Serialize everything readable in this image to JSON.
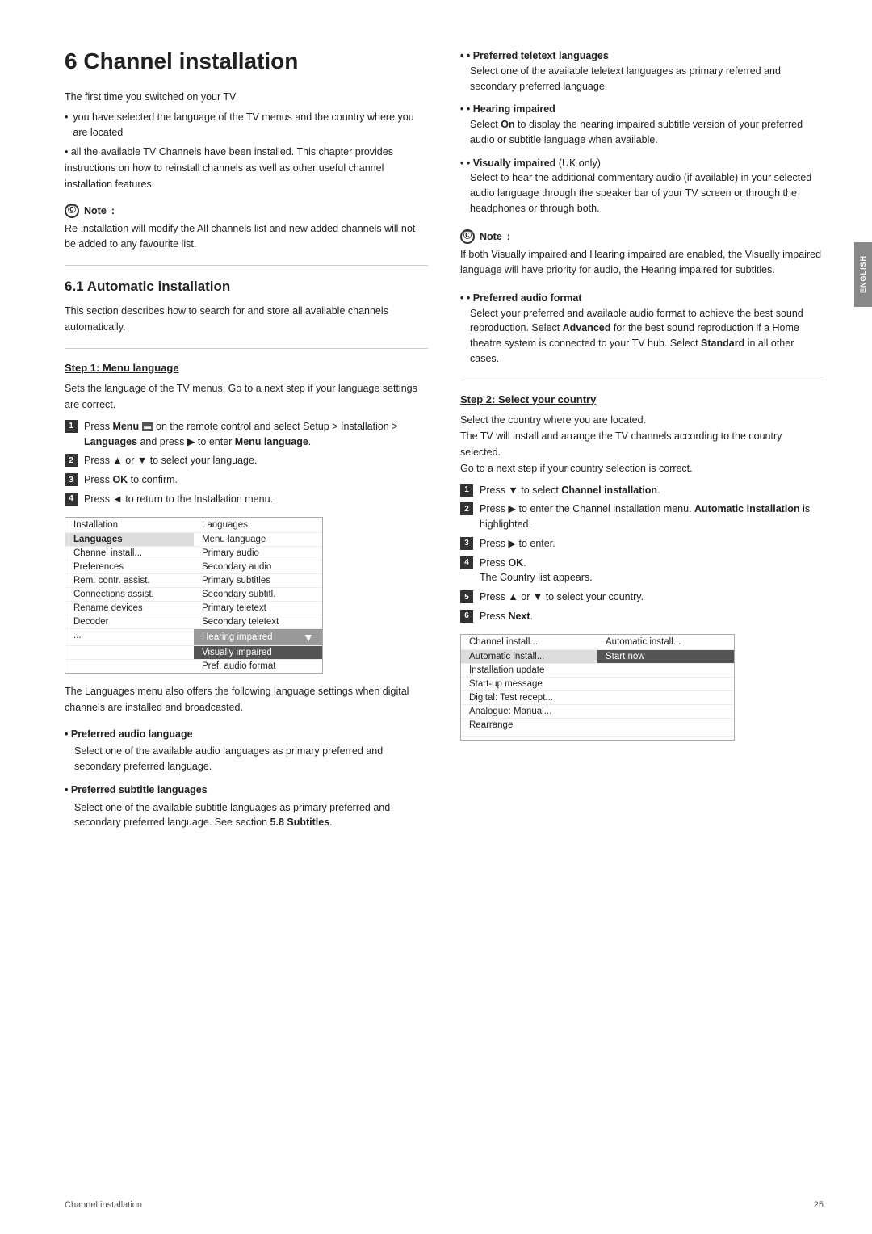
{
  "side_tab": "ENGLISH",
  "chapter": {
    "number": "6",
    "title": "Channel installation"
  },
  "intro": {
    "line1": "The first time you switched on your TV",
    "bullet1": "you have selected the language of the TV menus and the country where you are located",
    "bullet2": "all the available TV Channels have been installed. This chapter provides instructions on how to reinstall channels as well as other useful channel installation features."
  },
  "note1": {
    "label": "Note",
    "icon": "ⓘ",
    "text": "Re-installation will modify the All channels list and new added channels will not be added to any favourite list."
  },
  "section_61": {
    "heading": "6.1   Automatic installation",
    "intro": "This section describes how to search for and store all available channels automatically."
  },
  "step1": {
    "heading": "Step 1: Menu language",
    "desc": "Sets the language of the TV menus. Go to a next step if your language settings are correct.",
    "steps": [
      "Press Menu  on the remote control and select Setup > Installation > Languages and press ▶ to enter Menu language.",
      "Press ▲ or ▼ to select your language.",
      "Press OK to confirm.",
      "Press ◄ to return to the Installation menu."
    ]
  },
  "menu_table": {
    "col1": "Installation",
    "col2": "Languages",
    "rows": [
      {
        "left": "Languages",
        "right": "Menu language",
        "left_style": "selected-left",
        "right_style": ""
      },
      {
        "left": "Channel install...",
        "right": "Primary audio",
        "left_style": "",
        "right_style": ""
      },
      {
        "left": "Preferences",
        "right": "Secondary audio",
        "left_style": "",
        "right_style": ""
      },
      {
        "left": "Rem. contr. assist.",
        "right": "Primary subtitles",
        "left_style": "",
        "right_style": ""
      },
      {
        "left": "Connections assist.",
        "right": "Secondary subtitl.",
        "left_style": "",
        "right_style": ""
      },
      {
        "left": "Rename devices",
        "right": "Primary teletext",
        "left_style": "",
        "right_style": ""
      },
      {
        "left": "Decoder",
        "right": "Secondary teletext",
        "left_style": "",
        "right_style": ""
      },
      {
        "left": "...",
        "right": "Hearing impaired",
        "left_style": "",
        "right_style": "highlighted-right"
      },
      {
        "left": "",
        "right": "Visually impaired",
        "left_style": "",
        "right_style": "selected-right"
      },
      {
        "left": "",
        "right": "Pref. audio format",
        "left_style": "",
        "right_style": ""
      }
    ]
  },
  "lang_settings_intro": "The Languages menu also offers the following language settings when digital channels are installed and broadcasted.",
  "lang_bullets": [
    {
      "title": "Preferred audio language",
      "desc": "Select one of the available audio languages as primary preferred and secondary preferred language."
    },
    {
      "title": "Preferred subtitle languages",
      "desc": "Select one of the available subtitle languages as primary preferred and secondary preferred language. See section 5.8 Subtitles."
    }
  ],
  "right_col": {
    "bullets_top": [
      {
        "title": "Preferred teletext languages",
        "desc": "Select one of the available teletext languages as primary referred and secondary preferred language."
      },
      {
        "title": "Hearing impaired",
        "desc": "Select On to display the hearing impaired subtitle version of your preferred audio or subtitle language when available."
      },
      {
        "title": "Visually impaired (UK only)",
        "desc": "Select to hear the additional commentary audio (if available) in your selected audio language through the speaker bar of your TV screen or through the headphones or through both."
      }
    ],
    "note2": {
      "label": "Note",
      "icon": "ⓘ",
      "text": "If both Visually impaired and Hearing impaired are enabled, the Visually impaired language will have priority for audio, the Hearing impaired for subtitles."
    },
    "bullets_bottom": [
      {
        "title": "Preferred audio format",
        "desc": "Select your preferred and available audio format to achieve the best sound reproduction. Select Advanced for the best sound reproduction if a Home theatre system is connected to your TV hub. Select Standard in all other cases."
      }
    ],
    "step2": {
      "heading": "Step 2:  Select your country",
      "desc": "Select the country where you are located. The TV will install and arrange the TV channels according to the country selected. Go to a next step if your country selection is correct.",
      "steps": [
        "Press ▼ to select Channel installation.",
        "Press ▶ to enter the Channel installation menu. Automatic installation is highlighted.",
        "Press ▶ to enter.",
        "Press OK.\nThe Country list appears.",
        "Press ▲ or ▼ to select your country.",
        "Press Next."
      ]
    },
    "country_table": {
      "col1": "Channel install...",
      "col2": "Automatic install...",
      "rows": [
        {
          "left": "Automatic install...",
          "right": "Start now",
          "left_style": "selected-left",
          "right_style": "selected-right"
        },
        {
          "left": "Installation update",
          "right": "",
          "left_style": "",
          "right_style": ""
        },
        {
          "left": "Start-up message",
          "right": "",
          "left_style": "",
          "right_style": ""
        },
        {
          "left": "Digital: Test recept...",
          "right": "",
          "left_style": "",
          "right_style": ""
        },
        {
          "left": "Analogue: Manual...",
          "right": "",
          "left_style": "",
          "right_style": ""
        },
        {
          "left": "Rearrange",
          "right": "",
          "left_style": "",
          "right_style": ""
        },
        {
          "left": "",
          "right": "",
          "left_style": "",
          "right_style": ""
        },
        {
          "left": "",
          "right": "",
          "left_style": "",
          "right_style": ""
        }
      ]
    }
  },
  "footer": {
    "left": "Channel installation",
    "right": "25"
  }
}
